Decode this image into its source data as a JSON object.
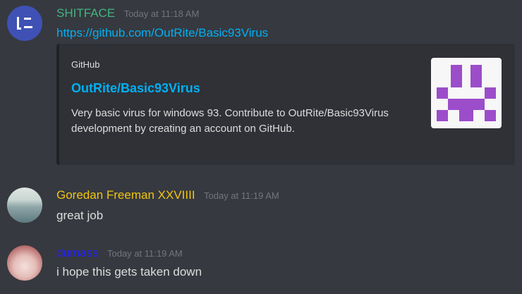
{
  "messages": [
    {
      "username": "SHITFACE",
      "username_color": "#43b581",
      "timestamp": "Today at 11:18 AM",
      "text": "https://github.com/OutRite/Basic93Virus",
      "embed": {
        "provider": "GitHub",
        "title": "OutRite/Basic93Virus",
        "description": "Very basic virus for windows 93. Contribute to OutRite/Basic93Virus development by creating an account on GitHub.",
        "thumbnail_icon": "github-identicon",
        "thumbnail_color": "#9b4dca"
      }
    },
    {
      "username": "Goredan Freeman XXVIIII",
      "username_color": "#f1c40f",
      "timestamp": "Today at 11:19 AM",
      "text": "great job"
    },
    {
      "username": "dumass",
      "username_color": "#1f1fff",
      "timestamp": "Today at 11:19 AM",
      "text": "i hope this gets taken down"
    }
  ]
}
